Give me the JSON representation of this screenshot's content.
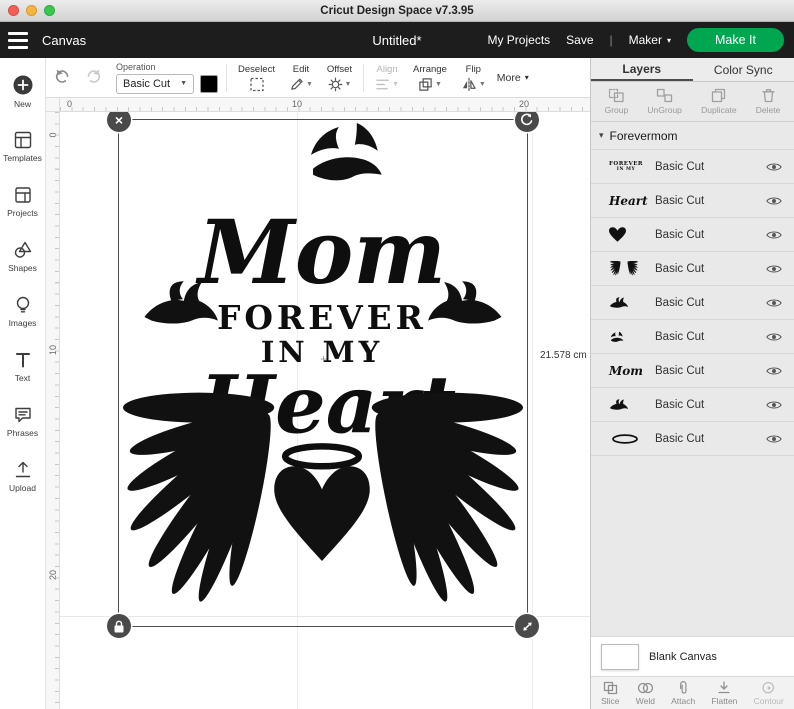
{
  "titlebar": {
    "title": "Cricut Design Space  v7.3.95"
  },
  "header": {
    "canvas_label": "Canvas",
    "document_title": "Untitled*",
    "my_projects_label": "My Projects",
    "save_label": "Save",
    "machine_label": "Maker",
    "make_it_label": "Make It"
  },
  "sidebar": {
    "items": [
      {
        "label": "New",
        "icon": "plus-circle-icon"
      },
      {
        "label": "Templates",
        "icon": "template-icon"
      },
      {
        "label": "Projects",
        "icon": "projects-board-icon"
      },
      {
        "label": "Shapes",
        "icon": "shapes-icon"
      },
      {
        "label": "Images",
        "icon": "lightbulb-icon"
      },
      {
        "label": "Text",
        "icon": "text-t-icon"
      },
      {
        "label": "Phrases",
        "icon": "speech-bubble-icon"
      },
      {
        "label": "Upload",
        "icon": "upload-arrow-icon"
      }
    ]
  },
  "toolbar": {
    "operation_label": "Operation",
    "operation_value": "Basic Cut",
    "deselect_label": "Deselect",
    "edit_label": "Edit",
    "offset_label": "Offset",
    "align_label": "Align",
    "arrange_label": "Arrange",
    "flip_label": "Flip",
    "more_label": "More"
  },
  "rulers": {
    "horizontal": [
      "0",
      "10",
      "20"
    ],
    "vertical": [
      "0",
      "10",
      "20"
    ]
  },
  "canvas": {
    "dimension_label": "21.578 cm",
    "artwork": {
      "word_mom": "Mom",
      "word_forever": "FOREVER",
      "word_in_my": "IN MY",
      "word_heart": "Heart"
    }
  },
  "layers_panel": {
    "tab_layers": "Layers",
    "tab_color_sync": "Color Sync",
    "action_group": "Group",
    "action_ungroup": "UnGroup",
    "action_duplicate": "Duplicate",
    "action_delete": "Delete",
    "group_name": "Forevermom",
    "layers": [
      {
        "label": "Basic Cut",
        "thumb": "text-forever-in-my",
        "thumb_top": "FOREVER",
        "thumb_bottom": "IN MY"
      },
      {
        "label": "Basic Cut",
        "thumb": "text-heart-script",
        "thumb_text": "Heart"
      },
      {
        "label": "Basic Cut",
        "thumb": "heart-shape"
      },
      {
        "label": "Basic Cut",
        "thumb": "angel-wings"
      },
      {
        "label": "Basic Cut",
        "thumb": "dove-side"
      },
      {
        "label": "Basic Cut",
        "thumb": "dove-flying"
      },
      {
        "label": "Basic Cut",
        "thumb": "text-mom-script",
        "thumb_text": "Mom"
      },
      {
        "label": "Basic Cut",
        "thumb": "dove-side"
      },
      {
        "label": "Basic Cut",
        "thumb": "halo-ellipse"
      }
    ],
    "blank_canvas_label": "Blank Canvas",
    "bottom_actions": [
      {
        "label": "Slice",
        "icon": "slice-icon"
      },
      {
        "label": "Weld",
        "icon": "weld-icon"
      },
      {
        "label": "Attach",
        "icon": "attach-paperclip-icon"
      },
      {
        "label": "Flatten",
        "icon": "flatten-icon"
      },
      {
        "label": "Contour",
        "icon": "contour-icon"
      }
    ]
  },
  "colors": {
    "make_it_green": "#00a650",
    "header_bg": "#1d1d1d",
    "artwork_black": "#0e0e0e"
  }
}
